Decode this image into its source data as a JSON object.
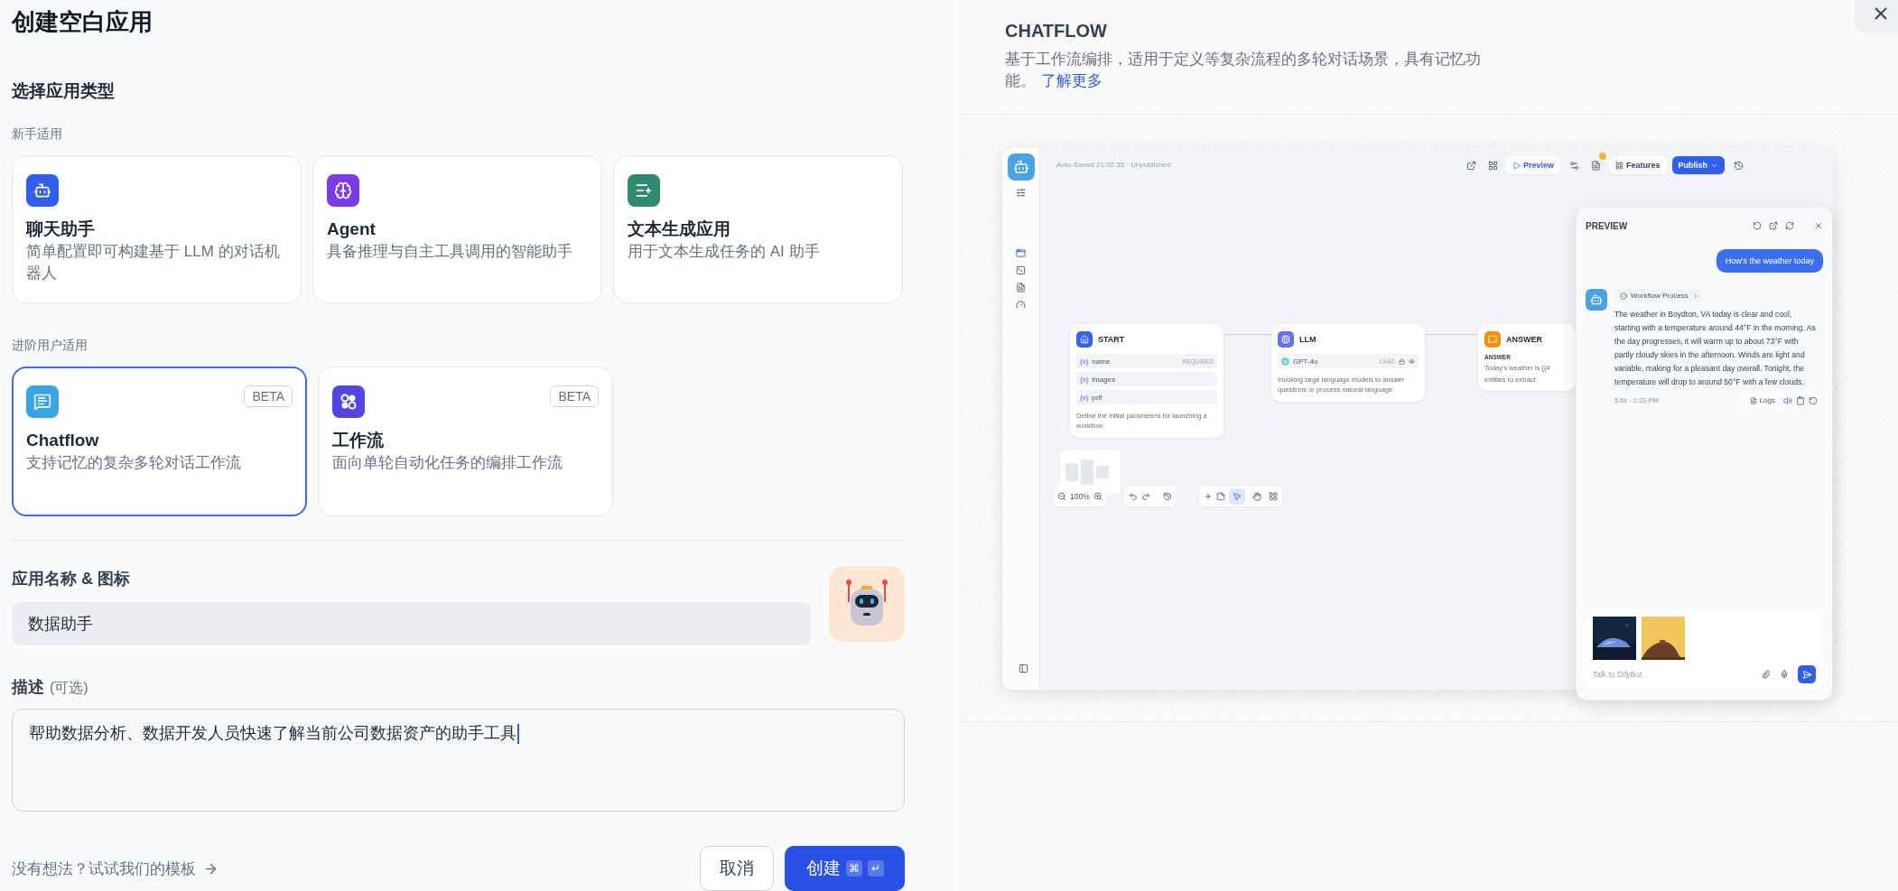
{
  "title": "创建空白应用",
  "app_type": {
    "heading": "选择应用类型",
    "groups": [
      {
        "label": "新手适用",
        "cards": [
          {
            "kind": "chat",
            "title": "聊天助手",
            "description": "简单配置即可构建基于 LLM 的对话机器人",
            "color": "#2f5ef0",
            "selected": false
          },
          {
            "kind": "agent",
            "title": "Agent",
            "description": "具备推理与自主工具调用的智能助手",
            "color": "#7c3aed",
            "selected": false
          },
          {
            "kind": "completion",
            "title": "文本生成应用",
            "description": "用于文本生成任务的 AI 助手",
            "color": "#2f8a70",
            "selected": false
          }
        ]
      },
      {
        "label": "进阶用户适用",
        "cards": [
          {
            "kind": "chatflow",
            "title": "Chatflow",
            "description": "支持记忆的复杂多轮对话工作流",
            "badge": "BETA",
            "color": "#38a5e6",
            "selected": true
          },
          {
            "kind": "workflow",
            "title": "工作流",
            "description": "面向单轮自动化任务的编排工作流",
            "badge": "BETA",
            "color": "#5046e5",
            "selected": false
          }
        ]
      }
    ]
  },
  "name_field": {
    "label": "应用名称 & 图标",
    "value": "数据助手"
  },
  "description_field": {
    "label": "描述",
    "hint": "(可选)",
    "value": "帮助数据分析、数据开发人员快速了解当前公司数据资产的助手工具"
  },
  "footer": {
    "template_link": "没有想法？试试我们的模板",
    "cancel": "取消",
    "create": "创建",
    "shortcut": [
      "⌘",
      "↵"
    ]
  },
  "preview": {
    "title": "CHATFLOW",
    "description": "基于工作流编排，适用于定义等复杂流程的多轮对话场景，具有记忆功能。",
    "learn_more": "了解更多",
    "screenshot": {
      "status": "Auto-Saved 21:02:35 · Unpublished",
      "preview_button": "Preview",
      "features_button": "Features",
      "publish_button": "Publish",
      "zoom": "100%",
      "nodes": [
        {
          "kind": "start",
          "title": "START",
          "fields": [
            {
              "mark": "{x}",
              "name": "name",
              "tag": "REQUIRED"
            },
            {
              "mark": "{x}",
              "name": "images"
            },
            {
              "mark": "{x}",
              "name": "pdf"
            }
          ],
          "description": "Define the initial parameters for launching a workflow"
        },
        {
          "kind": "llm",
          "title": "LLM",
          "model": "GPT-4o",
          "mode": "CHAT",
          "description": "Invoking large language models to answer questions or process natural language"
        },
        {
          "kind": "answer",
          "title": "ANSWER",
          "label": "ANSWER",
          "text": "Today's weather is {{#",
          "text_2": "entities to extract."
        }
      ],
      "tools": [
        {
          "kind": "pointer",
          "selected": true
        },
        {
          "kind": "hand",
          "selected": false
        }
      ],
      "chat": {
        "title": "PREVIEW",
        "user_message": "How's the weather today",
        "process": "Workflow Process",
        "reply": "The weather in Boydton, VA today is clear and cool, starting with a temperature around 44°F in the morning. As the day progresses, it will warm up to about 73°F with partly cloudy skies in the afternoon. Winds are light and variable, making for a pleasant day overall. Tonight, the temperature will drop to around 50°F with a few clouds.",
        "meta": "5.6s · 1:20 PM",
        "logs": "Logs",
        "placeholder": "Talk to DifyBot"
      }
    }
  }
}
